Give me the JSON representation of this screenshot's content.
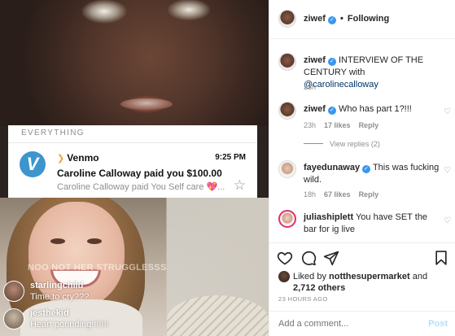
{
  "notification": {
    "section": "EVERYTHING",
    "app": "Venmo",
    "time": "9:25 PM",
    "title": "Caroline Calloway paid you $100.00",
    "body": "Caroline Calloway paid You Self care",
    "body_suffix": "...",
    "logo_letter": "V"
  },
  "live": {
    "ghost_comment": "NOO NOT HER STRUGGLESSS",
    "comments": [
      {
        "user": "starlingchild",
        "text": "Time to cry???"
      },
      {
        "user": "jesthekid",
        "text": "Heart pounding!!!!!!!"
      }
    ]
  },
  "post": {
    "header": {
      "username": "ziwef",
      "separator": "•",
      "follow_status": "Following"
    },
    "caption": {
      "username": "ziwef",
      "text": "INTERVIEW OF THE CENTURY with ",
      "mention": "@carolinecalloway",
      "time": "23h"
    },
    "comments": [
      {
        "username": "ziwef",
        "text": "Who has part 1?!!!",
        "time": "23h",
        "likes": "17 likes",
        "reply": "Reply"
      },
      {
        "username": "fayedunaway",
        "text": "This was fucking wild.",
        "time": "18h",
        "likes": "67 likes",
        "reply": "Reply"
      },
      {
        "username": "juliashiplett",
        "text": "You have SET the bar for ig live",
        "time": "",
        "likes": "",
        "reply": ""
      }
    ],
    "view_replies": "View replies (2)",
    "liked_by": {
      "prefix": "Liked by ",
      "user": "notthesupermarket",
      "mid": " and",
      "count": "2,712 others"
    },
    "time_ago": "23 HOURS AGO",
    "composer": {
      "placeholder": "Add a comment...",
      "post_label": "Post"
    }
  },
  "colors": {
    "venmo_blue": "#3d95ce",
    "verified_blue": "#3897f0",
    "post_disabled": "#b2dffc",
    "mention_link": "#003569"
  }
}
